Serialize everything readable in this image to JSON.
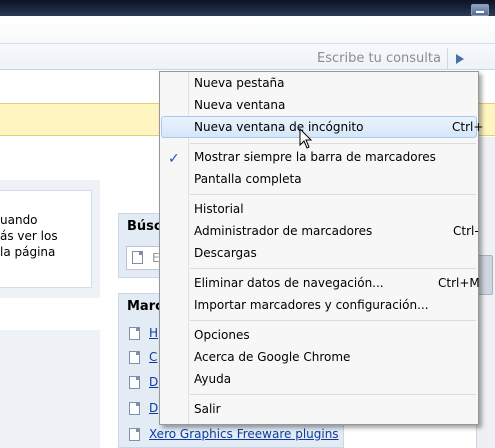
{
  "search": {
    "placeholder": "Escribe tu consulta"
  },
  "left_text": {
    "line1": "uando",
    "line2": "ás ver los",
    "line3": "la página"
  },
  "panels": {
    "search_title": "Búsc",
    "search_placeholder": "E",
    "marks_title": "Marc",
    "marks_links": [
      "H",
      "C",
      "D",
      "D",
      "Xero Graphics Freeware plugins"
    ]
  },
  "menu": {
    "items": [
      {
        "label": "Nueva pestaña",
        "shortcut": ""
      },
      {
        "label": "Nueva ventana",
        "shortcut": ""
      },
      {
        "label": "Nueva ventana de incógnito",
        "shortcut": "Ctrl+"
      },
      {
        "label": "Mostrar siempre la barra de marcadores",
        "shortcut": ""
      },
      {
        "label": "Pantalla completa",
        "shortcut": ""
      },
      {
        "label": "Historial",
        "shortcut": ""
      },
      {
        "label": "Administrador de marcadores",
        "shortcut": "Ctrl-"
      },
      {
        "label": "Descargas",
        "shortcut": ""
      },
      {
        "label": "Eliminar datos de navegación...",
        "shortcut": "Ctrl+M"
      },
      {
        "label": "Importar marcadores y configuración...",
        "shortcut": ""
      },
      {
        "label": "Opciones",
        "shortcut": ""
      },
      {
        "label": "Acerca de Google Chrome",
        "shortcut": ""
      },
      {
        "label": "Ayuda",
        "shortcut": ""
      },
      {
        "label": "Salir",
        "shortcut": ""
      }
    ],
    "checked_icon": "checkmark-icon"
  }
}
